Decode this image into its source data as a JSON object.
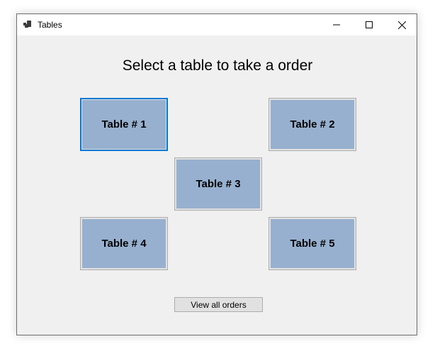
{
  "window": {
    "title": "Tables",
    "icon": "app-tables-icon",
    "controls": {
      "minimize_icon": "minimize-icon",
      "maximize_icon": "maximize-icon",
      "close_icon": "close-icon"
    }
  },
  "main": {
    "heading": "Select a table to take a order",
    "tables": [
      {
        "label": "Table # 1",
        "focused": true
      },
      {
        "label": "Table # 2"
      },
      {
        "label": "Table # 3"
      },
      {
        "label": "Table # 4"
      },
      {
        "label": "Table # 5"
      }
    ],
    "view_orders_label": "View all orders"
  },
  "colors": {
    "window_bg": "#f0f0f0",
    "table_face": "#97b0cf",
    "focus_border": "#0078d7"
  }
}
